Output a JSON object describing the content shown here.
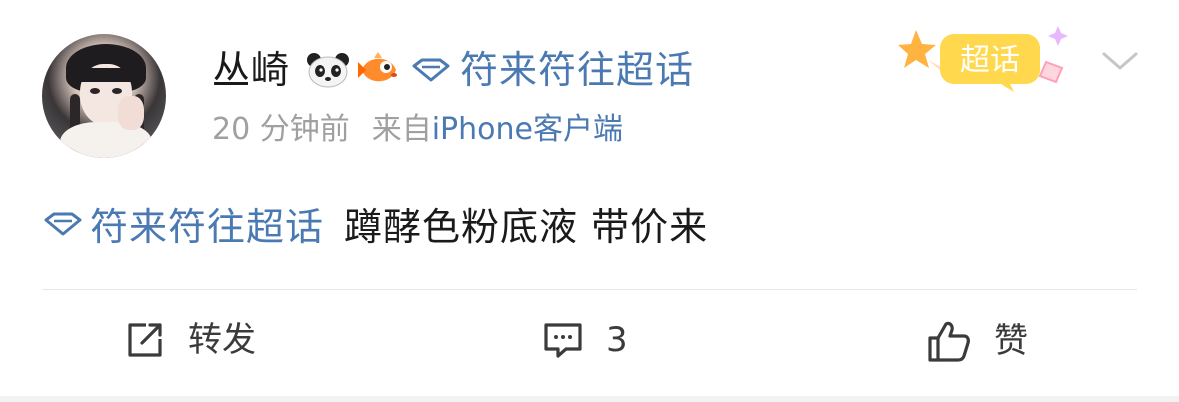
{
  "post": {
    "username": "丛崎",
    "emoji_badges": [
      "panda-icon",
      "fish-icon"
    ],
    "super_topic": "符来符往超话",
    "time": "20 分钟前",
    "source_prefix": "来自",
    "source_client": "iPhone客户端",
    "badge_label": "超话",
    "content_topic": "符来符往超话",
    "content_text": "蹲酵色粉底液 带价来"
  },
  "actions": {
    "forward_label": "转发",
    "comment_count": "3",
    "like_label": "赞"
  },
  "colors": {
    "link_blue": "#4b7ab2",
    "text": "#1a1a1a",
    "meta_gray": "#a0a0a0",
    "badge_yellow": "#ffd84d",
    "badge_pink": "#ff8fb0"
  }
}
